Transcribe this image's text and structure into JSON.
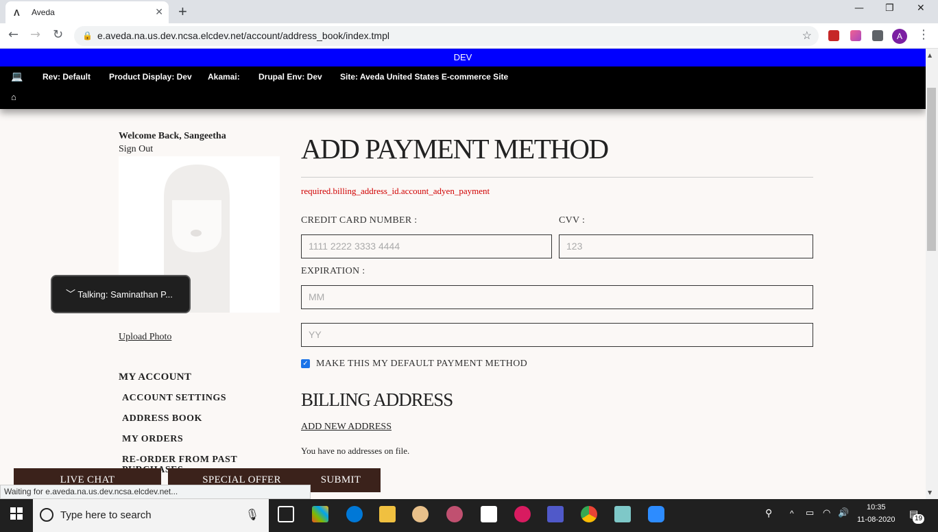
{
  "browser": {
    "tab_title": "Aveda",
    "tab_favicon": "Λ",
    "url": "e.aveda.na.us.dev.ncsa.elcdev.net/account/address_book/index.tmpl",
    "profile_initial": "A",
    "status_text": "Waiting for e.aveda.na.us.dev.ncsa.elcdev.net..."
  },
  "dev_bar": {
    "label": "DEV"
  },
  "env_bar": {
    "rev": "Rev: Default",
    "product_display": "Product Display: Dev",
    "akamai": "Akamai:",
    "drupal_env": "Drupal Env: Dev",
    "site": "Site: Aveda United States E-commerce Site"
  },
  "sidebar": {
    "welcome": "Welcome Back, Sangeetha",
    "sign_out": "Sign Out",
    "upload_photo": "Upload Photo",
    "my_account": "MY ACCOUNT",
    "items": [
      {
        "label": "ACCOUNT SETTINGS"
      },
      {
        "label": "ADDRESS BOOK"
      },
      {
        "label": "MY ORDERS"
      },
      {
        "label": "RE-ORDER FROM PAST PURCHASES"
      }
    ]
  },
  "chat_popup": {
    "label": "Talking: Saminathan P..."
  },
  "main": {
    "title": "ADD PAYMENT METHOD",
    "error": "required.billing_address_id.account_adyen_payment",
    "card_label": "CREDIT CARD NUMBER :",
    "card_placeholder": "1111 2222 3333 4444",
    "cvv_label": "CVV :",
    "cvv_placeholder": "123",
    "expiration_label": "EXPIRATION :",
    "mm_placeholder": "MM",
    "yy_placeholder": "YY",
    "default_label": "MAKE THIS MY DEFAULT PAYMENT METHOD",
    "default_checked": true,
    "billing_title": "BILLING ADDRESS",
    "add_new_address": "ADD NEW ADDRESS",
    "no_addresses": "You have no addresses on file.",
    "submit": "SUBMIT"
  },
  "sticky": {
    "live_chat": "LIVE CHAT",
    "special_offer": "SPECIAL OFFER"
  },
  "taskbar": {
    "search_placeholder": "Type here to search",
    "time": "10:35",
    "date": "11-08-2020",
    "notifications": "19"
  }
}
